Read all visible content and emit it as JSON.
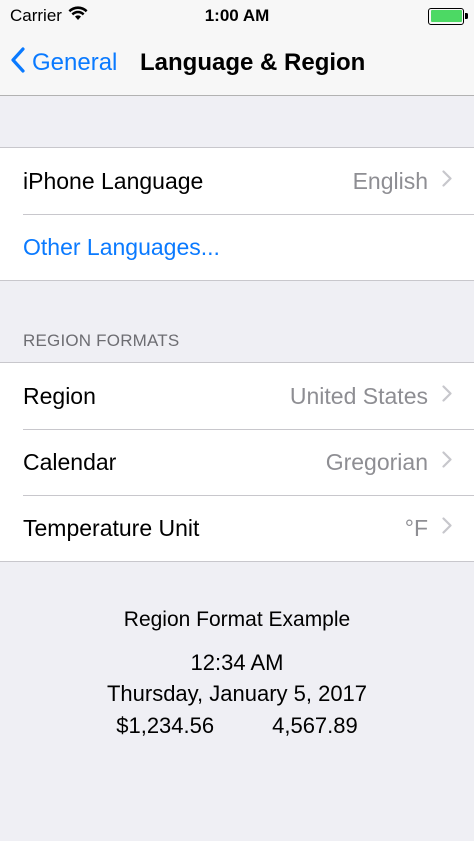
{
  "status_bar": {
    "carrier": "Carrier",
    "time": "1:00 AM",
    "battery_level": 1.0,
    "battery_color": "#4CD964",
    "wifi_icon": "wifi-icon"
  },
  "nav_bar": {
    "back_label": "General",
    "title": "Language & Region",
    "accent_color": "#0A7AFF"
  },
  "language_group": {
    "rows": [
      {
        "label": "iPhone Language",
        "value": "English"
      },
      {
        "label": "Other Languages..."
      }
    ]
  },
  "region_formats": {
    "header": "REGION FORMATS",
    "rows": [
      {
        "label": "Region",
        "value": "United States"
      },
      {
        "label": "Calendar",
        "value": "Gregorian"
      },
      {
        "label": "Temperature Unit",
        "value": "°F"
      }
    ]
  },
  "example": {
    "title": "Region Format Example",
    "time": "12:34 AM",
    "date": "Thursday, January 5, 2017",
    "currency": "$1,234.56",
    "number": "4,567.89"
  }
}
